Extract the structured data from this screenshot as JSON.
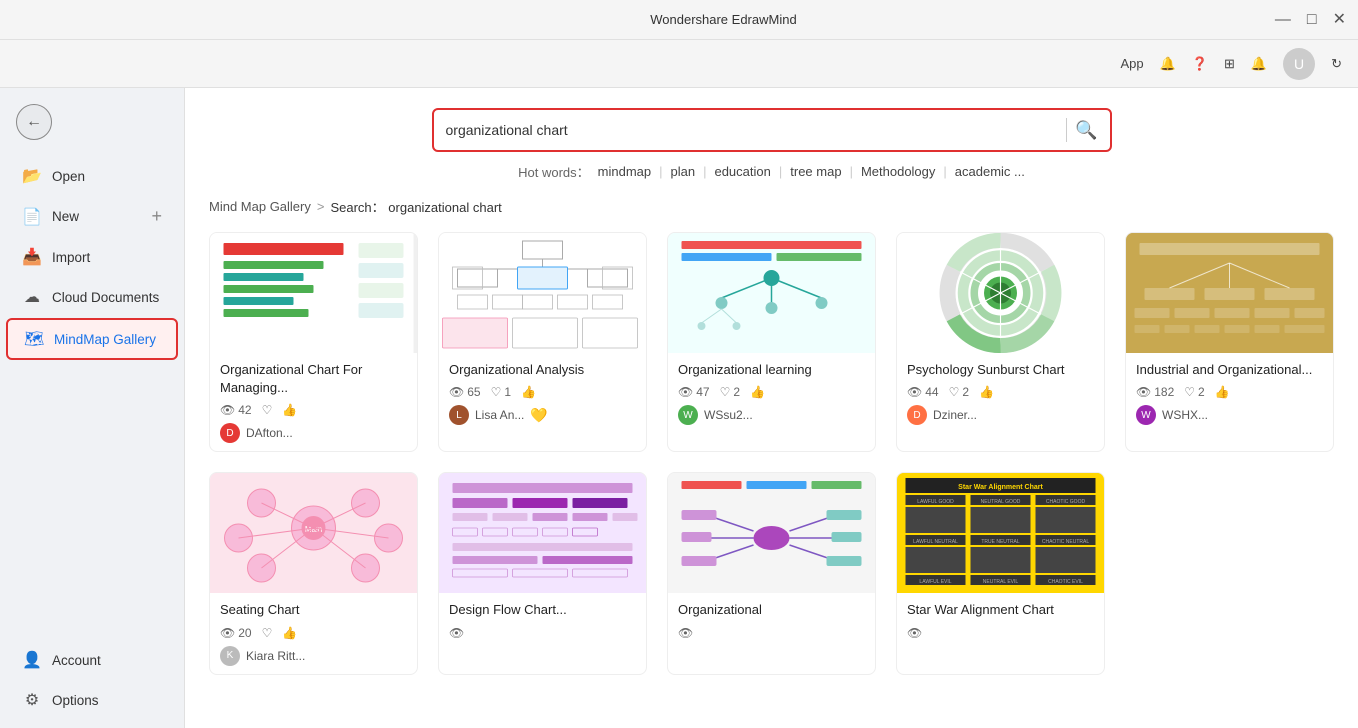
{
  "app": {
    "title": "Wondershare EdrawMind"
  },
  "titlebar": {
    "title": "Wondershare EdrawMind",
    "minimize": "—",
    "maximize": "□",
    "close": "✕"
  },
  "toolbar": {
    "app_label": "App",
    "notification_icon": "🔔",
    "help_icon": "?",
    "grid_icon": "⊞",
    "share_icon": "🔔"
  },
  "sidebar": {
    "items": [
      {
        "label": "Open",
        "icon": "📂"
      },
      {
        "label": "New",
        "icon": "📄",
        "has_plus": true
      },
      {
        "label": "Import",
        "icon": "📥"
      },
      {
        "label": "Cloud Documents",
        "icon": "☁"
      },
      {
        "label": "MindMap Gallery",
        "icon": "🗺",
        "active": true
      }
    ],
    "bottom_items": [
      {
        "label": "Account",
        "icon": "👤"
      },
      {
        "label": "Options",
        "icon": "⚙"
      }
    ]
  },
  "search": {
    "placeholder": "organizational chart",
    "value": "organizational chart",
    "hot_words_label": "Hot words：",
    "hot_words": [
      "mindmap",
      "plan",
      "education",
      "tree map",
      "Methodology",
      "academic ..."
    ]
  },
  "breadcrumb": {
    "gallery_label": "Mind Map Gallery",
    "separator": ">",
    "search_prefix": "Search：",
    "search_term": "organizational chart"
  },
  "gallery": {
    "title": "Mind Map Gallery",
    "cards": [
      {
        "id": 1,
        "title": "Organizational Chart For Managing...",
        "views": "42",
        "likes": "",
        "likes_count": "",
        "author": "DAfton...",
        "author_color": "#e53935",
        "img_type": "org1"
      },
      {
        "id": 2,
        "title": "Organizational Analysis",
        "views": "65",
        "likes": "1",
        "author": "Lisa An...",
        "author_color": "#a0522d",
        "has_gold": true,
        "img_type": "analysis"
      },
      {
        "id": 3,
        "title": "Organizational learning",
        "views": "47",
        "likes": "2",
        "author": "WSsu2...",
        "author_color": "#4caf50",
        "img_type": "learning"
      },
      {
        "id": 4,
        "title": "Psychology Sunburst Chart",
        "views": "44",
        "likes": "2",
        "author": "Dziner...",
        "author_color": "#ff5722",
        "img_type": "psychology"
      },
      {
        "id": 5,
        "title": "Industrial and Organizational...",
        "views": "182",
        "likes": "2",
        "author": "WSHX...",
        "author_color": "#9c27b0",
        "img_type": "industrial"
      },
      {
        "id": 6,
        "title": "Seating Chart",
        "views": "20",
        "likes": "",
        "author": "Kiara Ritt...",
        "author_color": "#aaa",
        "img_type": "seating"
      },
      {
        "id": 7,
        "title": "Design Flow Chart...",
        "views": "",
        "likes": "",
        "author": "",
        "img_type": "flow"
      },
      {
        "id": 8,
        "title": "Organizational",
        "views": "",
        "likes": "",
        "author": "",
        "img_type": "org2"
      },
      {
        "id": 9,
        "title": "Star War Alignment Chart",
        "views": "",
        "likes": "",
        "author": "",
        "img_type": "starwars"
      }
    ]
  }
}
